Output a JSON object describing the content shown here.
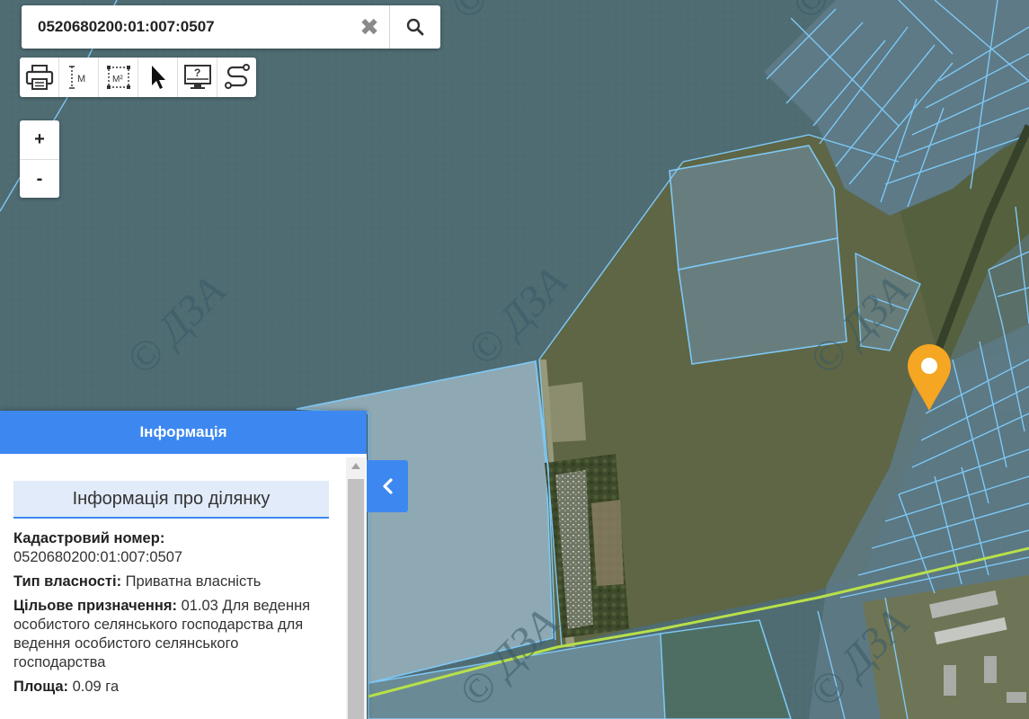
{
  "search": {
    "value": "0520680200:01:007:0507",
    "clear_icon": "close-icon",
    "search_icon": "search-icon"
  },
  "toolbar": {
    "tools": [
      {
        "name": "print",
        "icon": "printer-icon"
      },
      {
        "name": "measure-distance",
        "icon": "ruler-icon",
        "label": "M"
      },
      {
        "name": "measure-area",
        "icon": "area-icon",
        "label": "M²"
      },
      {
        "name": "select",
        "icon": "cursor-icon"
      },
      {
        "name": "info",
        "icon": "monitor-question-icon",
        "label": "?"
      },
      {
        "name": "route",
        "icon": "route-icon"
      }
    ]
  },
  "zoom": {
    "in_label": "+",
    "out_label": "-"
  },
  "map": {
    "watermark": "© ДЗА",
    "parcel_line_color": "#7ec8f5",
    "road_color": "#b8e04a",
    "marker_color": "#f5a623"
  },
  "info_panel": {
    "header": "Інформація",
    "section_title": "Інформація про ділянку",
    "cadastral_label": "Кадастровий номер:",
    "cadastral_value": "0520680200:01:007:0507",
    "ownership_label": "Тип власності:",
    "ownership_value": "Приватна власність",
    "purpose_label": "Цільове призначення:",
    "purpose_value": "01.03 Для ведення особистого селянського господарства для ведення особистого селянського господарства",
    "area_label": "Площа:",
    "area_value": "0.09 га"
  },
  "accent_color": "#3d88f0"
}
